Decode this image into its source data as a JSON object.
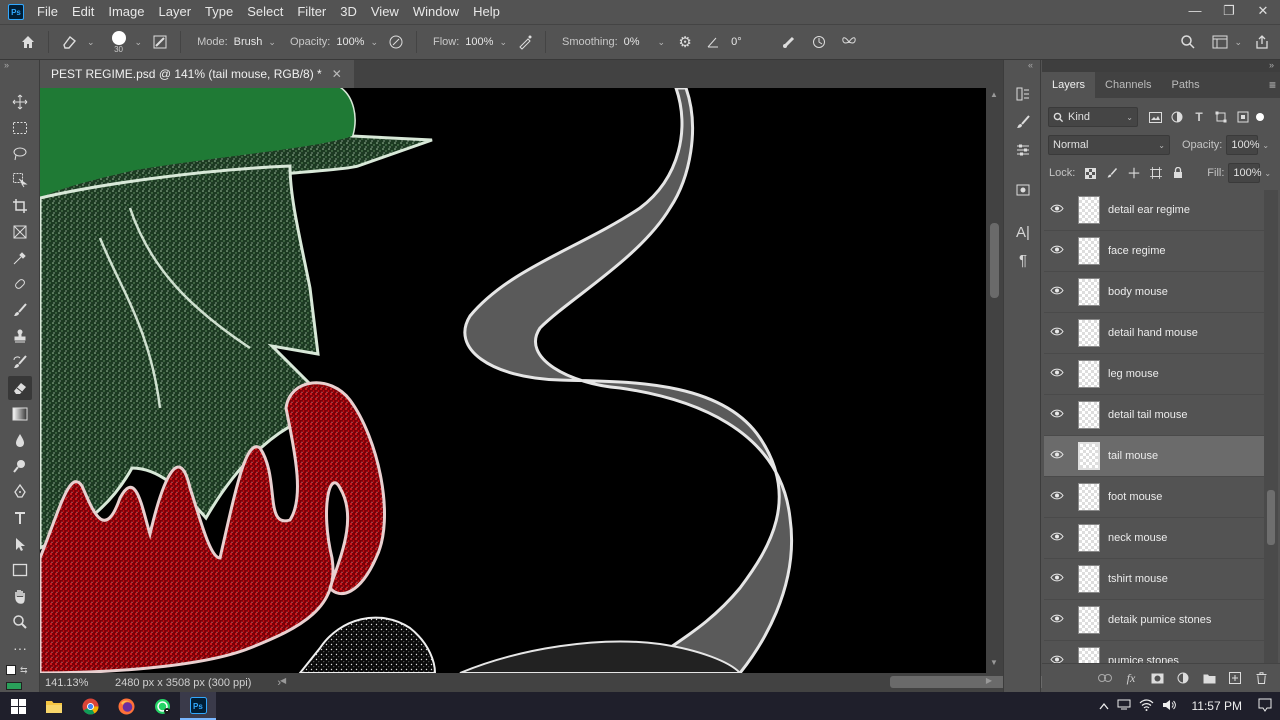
{
  "app": {
    "logo_text": "Ps",
    "menu": [
      "File",
      "Edit",
      "Image",
      "Layer",
      "Type",
      "Select",
      "Filter",
      "3D",
      "View",
      "Window",
      "Help"
    ],
    "window_controls": [
      "—",
      "❐",
      "✕"
    ]
  },
  "options_bar": {
    "brush_size": "30",
    "mode_label": "Mode:",
    "mode_value": "Brush",
    "opacity_label": "Opacity:",
    "opacity_value": "100%",
    "flow_label": "Flow:",
    "flow_value": "100%",
    "smoothing_label": "Smoothing:",
    "smoothing_value": "0%",
    "angle_value": "0°"
  },
  "document": {
    "tab_title": "PEST REGIME.psd @ 141% (tail mouse, RGB/8) *",
    "tab_close": "✕",
    "zoom": "141.13%",
    "doc_info": "2480 px x 3508 px (300 ppi)"
  },
  "layers_panel": {
    "tabs": [
      "Layers",
      "Channels",
      "Paths"
    ],
    "active_tab": "Layers",
    "filter_kind": "Kind",
    "blend_mode": "Normal",
    "opacity_label": "Opacity:",
    "opacity_value": "100%",
    "lock_label": "Lock:",
    "fill_label": "Fill:",
    "fill_value": "100%",
    "layers": [
      {
        "name": "detail ear regime",
        "visible": true,
        "selected": false
      },
      {
        "name": "face regime",
        "visible": true,
        "selected": false
      },
      {
        "name": "body mouse",
        "visible": true,
        "selected": false
      },
      {
        "name": "detail hand mouse",
        "visible": true,
        "selected": false
      },
      {
        "name": "leg mouse",
        "visible": true,
        "selected": false
      },
      {
        "name": "detail tail mouse",
        "visible": true,
        "selected": false
      },
      {
        "name": "tail mouse",
        "visible": true,
        "selected": true
      },
      {
        "name": "foot mouse",
        "visible": true,
        "selected": false
      },
      {
        "name": "neck mouse",
        "visible": true,
        "selected": false
      },
      {
        "name": "tshirt mouse",
        "visible": true,
        "selected": false
      },
      {
        "name": "detaik pumice stones",
        "visible": true,
        "selected": false
      },
      {
        "name": "pumice stones",
        "visible": true,
        "selected": false
      }
    ],
    "footer_icons": [
      "link-icon",
      "fx-icon",
      "mask-icon",
      "adjustment-icon",
      "group-icon",
      "new-layer-icon",
      "trash-icon"
    ]
  },
  "taskbar": {
    "time": "11:57 PM",
    "apps": [
      "file-explorer",
      "chrome",
      "firefox",
      "whatsapp",
      "photoshop"
    ]
  },
  "colors": {
    "ui_bg": "#535353",
    "canvas_bg": "#000000",
    "accent": "#31a8ff"
  }
}
